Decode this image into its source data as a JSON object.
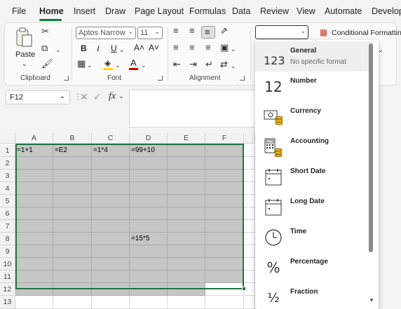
{
  "menu": {
    "tabs": [
      "File",
      "Home",
      "Insert",
      "Draw",
      "Page Layout",
      "Formulas",
      "Data",
      "Review",
      "View",
      "Automate",
      "Develop"
    ]
  },
  "ribbon": {
    "clipboard": {
      "paste_label": "Paste",
      "group_label": "Clipboard"
    },
    "font": {
      "font_name": "Aptos Narrow",
      "font_size": "11",
      "group_label": "Font",
      "bold": "B",
      "italic": "I",
      "underline": "U",
      "grow": "A˄",
      "shrink": "A˅"
    },
    "alignment": {
      "group_label": "Alignment"
    },
    "number": {
      "format_value": ""
    },
    "styles": {
      "conditional_formatting": "Conditional Formatting"
    }
  },
  "formula_bar": {
    "name_box": "F12",
    "fx": "fx"
  },
  "grid": {
    "columns": [
      "A",
      "B",
      "C",
      "D",
      "E",
      "F"
    ],
    "rows": [
      "1",
      "2",
      "3",
      "4",
      "5",
      "6",
      "7",
      "8",
      "9",
      "10",
      "11",
      "12",
      "13"
    ],
    "cells": {
      "A1": "=1+1",
      "B1": "=E2",
      "C1": "=1*4",
      "D1": "=99+10",
      "D8": "=15*5"
    }
  },
  "number_format_menu": [
    {
      "label": "General",
      "sub": "No specific format",
      "icon": "general-123-icon"
    },
    {
      "label": "Number",
      "icon": "number-12-icon"
    },
    {
      "label": "Currency",
      "icon": "currency-icon"
    },
    {
      "label": "Accounting",
      "icon": "accounting-icon"
    },
    {
      "label": "Short Date",
      "icon": "short-date-calendar-icon"
    },
    {
      "label": "Long Date",
      "icon": "long-date-calendar-icon"
    },
    {
      "label": "Time",
      "icon": "clock-icon"
    },
    {
      "label": "Percentage",
      "icon": "percent-icon"
    },
    {
      "label": "Fraction",
      "icon": "fraction-icon"
    }
  ],
  "colors": {
    "accent": "#107c41",
    "selection": "#217346",
    "selected_fill": "#c6c6c6"
  }
}
